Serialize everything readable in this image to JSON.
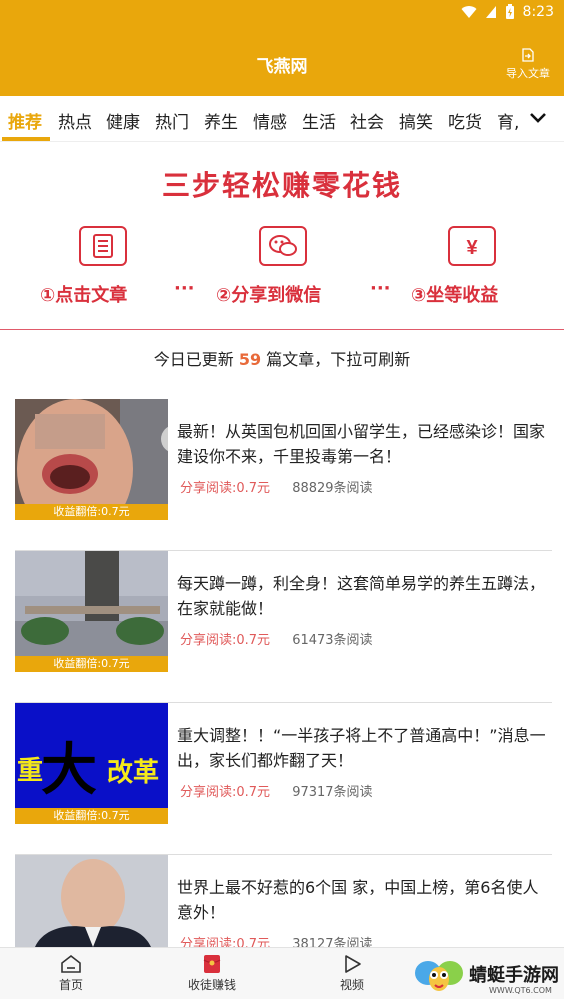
{
  "status": {
    "time": "8:23"
  },
  "header": {
    "title": "飞燕网",
    "import_label": "导入文章"
  },
  "tabs": [
    "推荐",
    "热点",
    "健康",
    "热门",
    "养生",
    "情感",
    "生活",
    "社会",
    "搞笑",
    "吃货",
    "育,"
  ],
  "banner": {
    "title": "三步轻松赚零花钱",
    "steps": [
      "①点击文章",
      "②分享到微信",
      "③坐等收益"
    ],
    "dots": "···",
    "yen": "¥"
  },
  "refresh": {
    "prefix": "今日已更新",
    "count": "59",
    "suffix": "篇文章，下拉可刷新"
  },
  "articles": [
    {
      "title": "最新！从英国包机回国小留学生，已经感染诊！国家建设你不来，千里投毒第一名！",
      "reward": "分享阅读:0.7元",
      "reads": "88829条阅读",
      "caption": "收益翻倍:0.7元"
    },
    {
      "title": " 每天蹲一蹲，利全身！这套简单易学的养生五蹲法，在家就能做！",
      "reward": "分享阅读:0.7元",
      "reads": "61473条阅读",
      "caption": "收益翻倍:0.7元"
    },
    {
      "title": "重大调整！！“一半孩子将上不了普通高中！”消息一出，家长们都炸翻了天！",
      "reward": "分享阅读:0.7元",
      "reads": "97317条阅读",
      "caption": "收益翻倍:0.7元",
      "thumb_text": [
        "重",
        "大",
        "改革"
      ]
    },
    {
      "title": "世界上最不好惹的6个国 家，中国上榜，第6名使人意外！",
      "reward": "分享阅读:0.7元",
      "reads": "38127条阅读"
    }
  ],
  "bottom_nav": [
    "首页",
    "收徒赚钱",
    "视频"
  ],
  "watermark": {
    "text": "蜻蜓手游网",
    "sub": "WWW.QT6.COM"
  },
  "colors": {
    "brand": "#E9A70C",
    "accent_red": "#D9303C",
    "reward_red": "#E05A5A"
  }
}
